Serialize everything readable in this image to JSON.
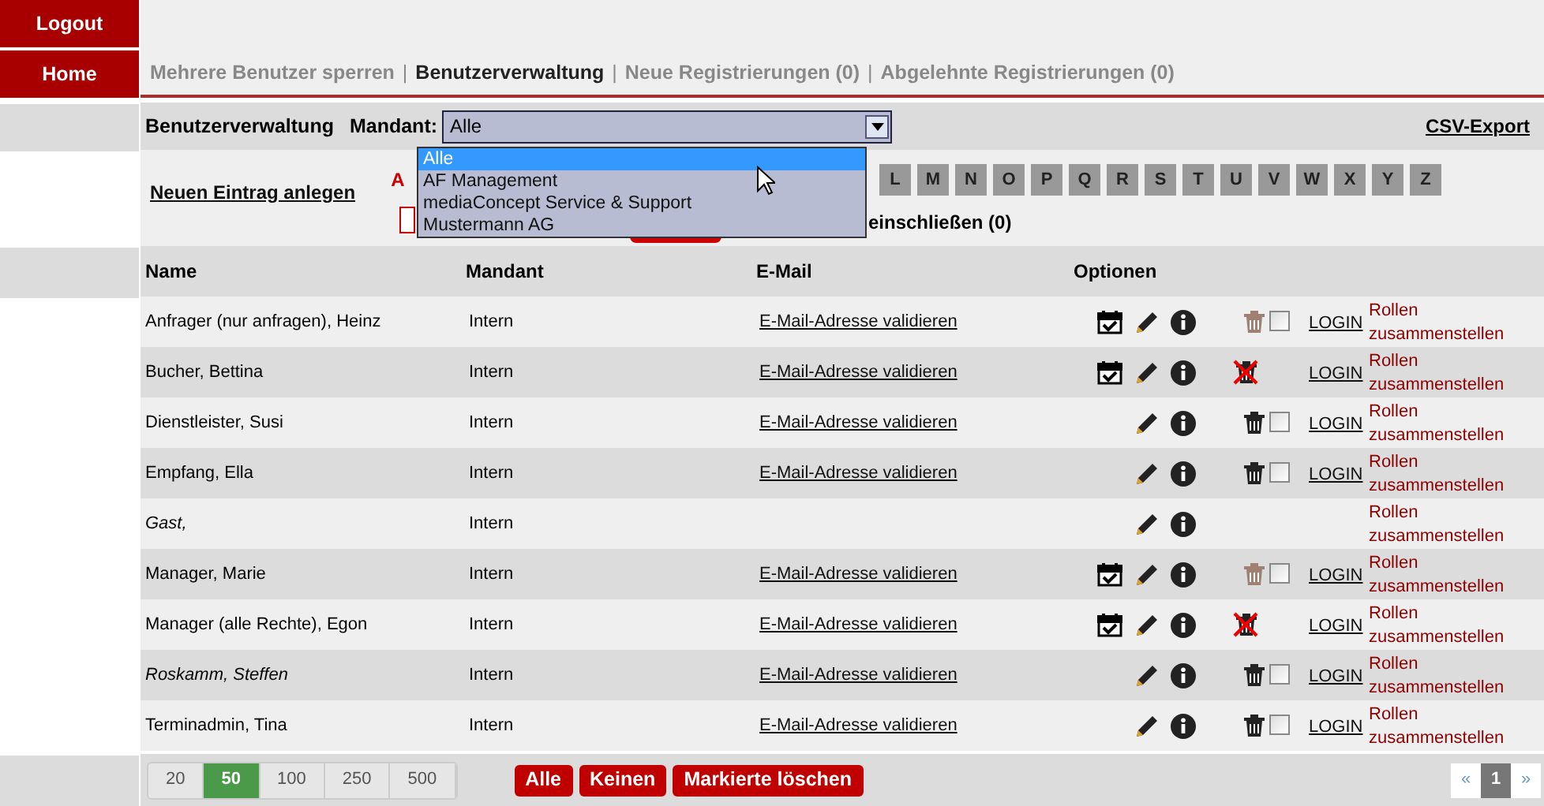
{
  "sidebar": {
    "items": [
      {
        "label": "Logout"
      },
      {
        "label": "Home"
      }
    ]
  },
  "nav": {
    "links": [
      {
        "label": "Mehrere Benutzer sperren",
        "selected": false
      },
      {
        "label": "Benutzerverwaltung",
        "selected": true
      },
      {
        "label": "Neue Registrierungen (0)",
        "selected": false
      },
      {
        "label": "Abgelehnte Registrierungen (0)",
        "selected": false
      }
    ],
    "separator": "|"
  },
  "toolbar": {
    "title": "Benutzerverwaltung",
    "mandant_label": "Mandant:",
    "mandant_value": "Alle",
    "export": "CSV-Export"
  },
  "dropdown": {
    "options": [
      {
        "label": "Alle",
        "selected": true
      },
      {
        "label": "AF Management",
        "selected": false
      },
      {
        "label": "mediaConcept Service & Support",
        "selected": false
      },
      {
        "label": "Mustermann AG",
        "selected": false
      }
    ]
  },
  "new_entry": "Neuen Eintrag anlegen",
  "letters": [
    {
      "label": "A",
      "selected": true
    },
    {
      "label": "L",
      "selected": false
    },
    {
      "label": "M",
      "selected": false
    },
    {
      "label": "N",
      "selected": false
    },
    {
      "label": "O",
      "selected": false
    },
    {
      "label": "P",
      "selected": false
    },
    {
      "label": "Q",
      "selected": false
    },
    {
      "label": "R",
      "selected": false
    },
    {
      "label": "S",
      "selected": false
    },
    {
      "label": "T",
      "selected": false
    },
    {
      "label": "U",
      "selected": false
    },
    {
      "label": "V",
      "selected": false
    },
    {
      "label": "W",
      "selected": false
    },
    {
      "label": "X",
      "selected": false
    },
    {
      "label": "Y",
      "selected": false
    },
    {
      "label": "Z",
      "selected": false
    }
  ],
  "include_label": "einschließen (0)",
  "table": {
    "columns": [
      "Name",
      "Mandant",
      "E-Mail",
      "Optionen"
    ],
    "rows": [
      {
        "name": "Anfrager (nur anfragen), Heinz",
        "italic": false,
        "mandant": "Intern",
        "email": "E-Mail-Adresse validieren",
        "calendar": true,
        "delete": {
          "kind": "trash",
          "disabled": true
        },
        "checkbox": {
          "checked": false
        },
        "login": "LOGIN",
        "roles": "Rollen zusammenstellen"
      },
      {
        "name": "Bucher, Bettina",
        "italic": false,
        "mandant": "Intern",
        "email": "E-Mail-Adresse validieren",
        "calendar": true,
        "delete": {
          "kind": "blocked"
        },
        "login": "LOGIN",
        "roles": "Rollen zusammenstellen"
      },
      {
        "name": "Dienstleister, Susi",
        "italic": false,
        "mandant": "Intern",
        "email": "E-Mail-Adresse validieren",
        "calendar": false,
        "delete": {
          "kind": "trash",
          "disabled": false
        },
        "checkbox": {
          "checked": false
        },
        "login": "LOGIN",
        "roles": "Rollen zusammenstellen"
      },
      {
        "name": "Empfang, Ella",
        "italic": false,
        "mandant": "Intern",
        "email": "E-Mail-Adresse validieren",
        "calendar": false,
        "delete": {
          "kind": "trash",
          "disabled": false
        },
        "checkbox": {
          "checked": false
        },
        "login": "LOGIN",
        "roles": "Rollen zusammenstellen"
      },
      {
        "name": "Gast,",
        "italic": true,
        "mandant": "Intern",
        "calendar": false,
        "roles": "Rollen zusammenstellen"
      },
      {
        "name": "Manager, Marie",
        "italic": false,
        "mandant": "Intern",
        "email": "E-Mail-Adresse validieren",
        "calendar": true,
        "delete": {
          "kind": "trash",
          "disabled": true
        },
        "checkbox": {
          "checked": false
        },
        "login": "LOGIN",
        "roles": "Rollen zusammenstellen"
      },
      {
        "name": "Manager (alle Rechte), Egon",
        "italic": false,
        "mandant": "Intern",
        "email": "E-Mail-Adresse validieren",
        "calendar": true,
        "delete": {
          "kind": "blocked"
        },
        "login": "LOGIN",
        "roles": "Rollen zusammenstellen"
      },
      {
        "name": "Roskamm, Steffen",
        "italic": true,
        "mandant": "Intern",
        "email": "E-Mail-Adresse validieren",
        "calendar": false,
        "delete": {
          "kind": "trash",
          "disabled": false
        },
        "checkbox": {
          "checked": false
        },
        "login": "LOGIN",
        "roles": "Rollen zusammenstellen"
      },
      {
        "name": "Terminadmin, Tina",
        "italic": false,
        "mandant": "Intern",
        "email": "E-Mail-Adresse validieren",
        "calendar": false,
        "delete": {
          "kind": "trash",
          "disabled": false
        },
        "checkbox": {
          "checked": false
        },
        "login": "LOGIN",
        "roles": "Rollen zusammenstellen"
      }
    ]
  },
  "page_sizes": [
    {
      "label": "20",
      "selected": false
    },
    {
      "label": "50",
      "selected": true
    },
    {
      "label": "100",
      "selected": false
    },
    {
      "label": "250",
      "selected": false
    },
    {
      "label": "500",
      "selected": false
    }
  ],
  "actions": [
    "Alle",
    "Keinen",
    "Markierte löschen"
  ],
  "pagination": {
    "prev": "«",
    "pages": [
      {
        "label": "1",
        "selected": true
      }
    ],
    "next": "»"
  }
}
